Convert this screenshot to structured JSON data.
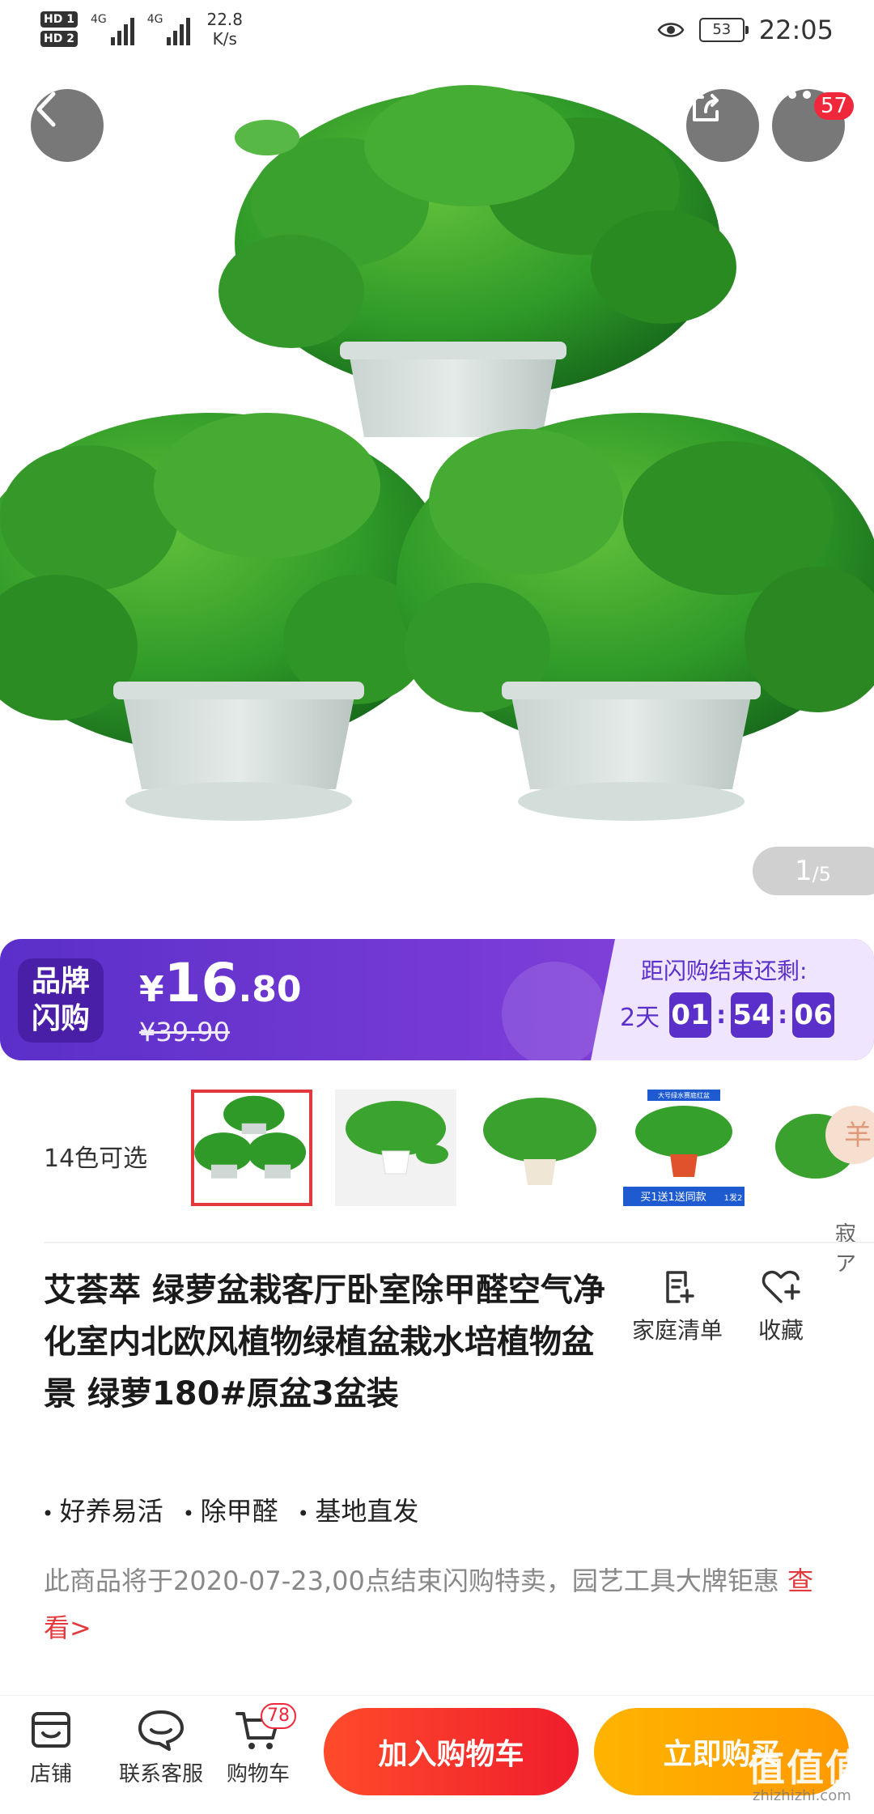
{
  "status_bar": {
    "hd1": "HD 1",
    "hd2": "HD 2",
    "net1": "4G",
    "net2": "4G",
    "speed_value": "22.8",
    "speed_unit": "K/s",
    "battery": "53",
    "time": "22:05"
  },
  "top_actions": {
    "more_badge": "57"
  },
  "gallery": {
    "current": "1",
    "total": "/5"
  },
  "flash_sale": {
    "brand_tag_line1": "品牌",
    "brand_tag_line2": "闪购",
    "currency": "¥",
    "price_int": "16",
    "price_dec": ".80",
    "original_price": "¥39.90",
    "countdown_title": "距闪购结束还剩:",
    "days": "2天",
    "hours": "01",
    "minutes": "54",
    "seconds": "06",
    "colors": {
      "primary": "#5b2fc9",
      "panel": "#efe5ff"
    }
  },
  "variants": {
    "label": "14色可选",
    "side_text": "寂ア",
    "thumb5_text": "羊",
    "thumb4_banner": "大号绿水赛庭红盆",
    "thumb4_footer": "买1送1送同款",
    "thumb4_tag": "1发2"
  },
  "product": {
    "title": "艾荟萃 绿萝盆栽客厅卧室除甲醛空气净化室内北欧风植物绿植盆栽水培植物盆景 绿萝180#原盆3盆装",
    "tags": [
      "好养易活",
      "除甲醛",
      "基地直发"
    ],
    "notice": "此商品将于2020-07-23,00点结束闪购特卖，园艺工具大牌钜惠 ",
    "notice_link": "查看>",
    "family_list": "家庭清单",
    "favorite": "收藏"
  },
  "bottom_bar": {
    "shop": "店铺",
    "service": "联系客服",
    "cart": "购物车",
    "cart_badge": "78",
    "add_to_cart": "加入购物车",
    "buy_now": "立即购买",
    "watermark": "值值值",
    "watermark_small": "zhizhizhi.com"
  }
}
